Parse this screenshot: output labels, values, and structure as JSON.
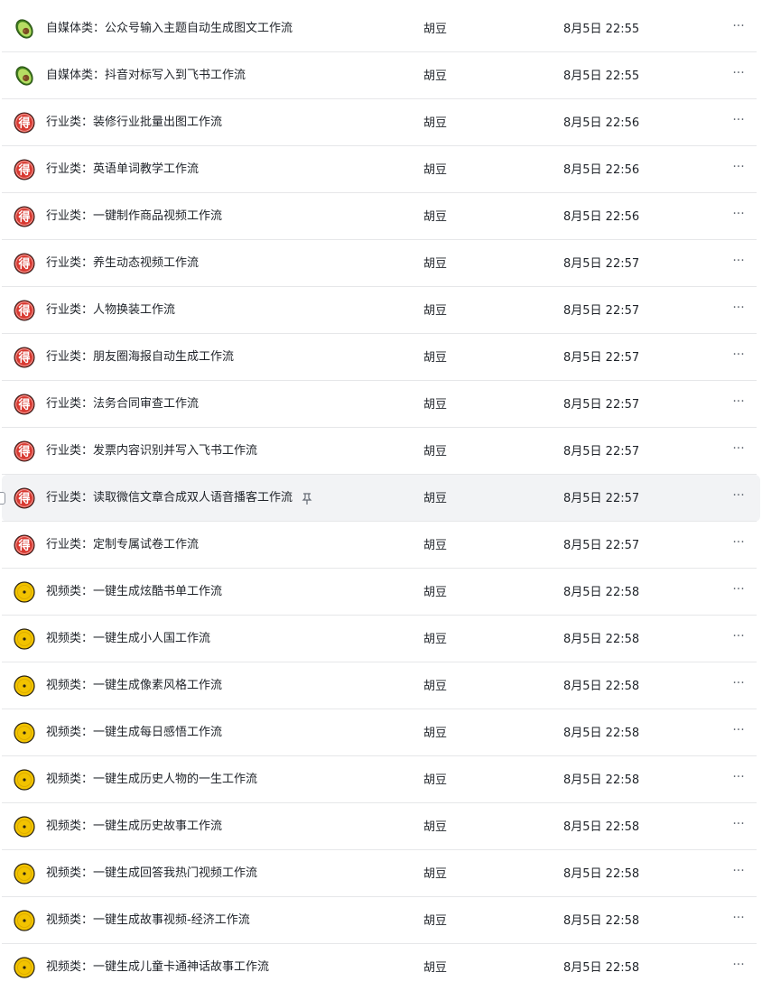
{
  "colors": {
    "row_divider": "#e6e7e9",
    "hover_bg": "#f2f3f5",
    "text": "#1f2329",
    "muted": "#646a73",
    "icon_red": "#d83931",
    "icon_yellow": "#f2c300",
    "icon_green": "#7cc341"
  },
  "more_glyph": "···",
  "rows": [
    {
      "icon": "avocado-icon",
      "title": "自媒体类：公众号输入主题自动生成图文工作流",
      "owner": "胡豆",
      "time": "8月5日 22:55"
    },
    {
      "icon": "avocado-icon",
      "title": "自媒体类：抖音对标写入到飞书工作流",
      "owner": "胡豆",
      "time": "8月5日 22:55"
    },
    {
      "icon": "de-badge-icon",
      "title": "行业类：装修行业批量出图工作流",
      "owner": "胡豆",
      "time": "8月5日 22:56",
      "badge": "得"
    },
    {
      "icon": "de-badge-icon",
      "title": "行业类：英语单词教学工作流",
      "owner": "胡豆",
      "time": "8月5日 22:56",
      "badge": "得"
    },
    {
      "icon": "de-badge-icon",
      "title": "行业类：一键制作商品视频工作流",
      "owner": "胡豆",
      "time": "8月5日 22:56",
      "badge": "得"
    },
    {
      "icon": "de-badge-icon",
      "title": "行业类：养生动态视频工作流",
      "owner": "胡豆",
      "time": "8月5日 22:57",
      "badge": "得"
    },
    {
      "icon": "de-badge-icon",
      "title": "行业类：人物换装工作流",
      "owner": "胡豆",
      "time": "8月5日 22:57",
      "badge": "得"
    },
    {
      "icon": "de-badge-icon",
      "title": "行业类：朋友圈海报自动生成工作流",
      "owner": "胡豆",
      "time": "8月5日 22:57",
      "badge": "得"
    },
    {
      "icon": "de-badge-icon",
      "title": "行业类：法务合同审查工作流",
      "owner": "胡豆",
      "time": "8月5日 22:57",
      "badge": "得"
    },
    {
      "icon": "de-badge-icon",
      "title": "行业类：发票内容识别并写入飞书工作流",
      "owner": "胡豆",
      "time": "8月5日 22:57",
      "badge": "得"
    },
    {
      "icon": "de-badge-icon",
      "title": "行业类：读取微信文章合成双人语音播客工作流",
      "owner": "胡豆",
      "time": "8月5日 22:57",
      "badge": "得",
      "hovered": true,
      "pin": "pin-icon"
    },
    {
      "icon": "de-badge-icon",
      "title": "行业类：定制专属试卷工作流",
      "owner": "胡豆",
      "time": "8月5日 22:57",
      "badge": "得"
    },
    {
      "icon": "vinyl-disc-icon",
      "title": "视频类：一键生成炫酷书单工作流",
      "owner": "胡豆",
      "time": "8月5日 22:58"
    },
    {
      "icon": "vinyl-disc-icon",
      "title": "视频类：一键生成小人国工作流",
      "owner": "胡豆",
      "time": "8月5日 22:58"
    },
    {
      "icon": "vinyl-disc-icon",
      "title": "视频类：一键生成像素风格工作流",
      "owner": "胡豆",
      "time": "8月5日 22:58"
    },
    {
      "icon": "vinyl-disc-icon",
      "title": "视频类：一键生成每日感悟工作流",
      "owner": "胡豆",
      "time": "8月5日 22:58"
    },
    {
      "icon": "vinyl-disc-icon",
      "title": "视频类：一键生成历史人物的一生工作流",
      "owner": "胡豆",
      "time": "8月5日 22:58"
    },
    {
      "icon": "vinyl-disc-icon",
      "title": "视频类：一键生成历史故事工作流",
      "owner": "胡豆",
      "time": "8月5日 22:58"
    },
    {
      "icon": "vinyl-disc-icon",
      "title": "视频类：一键生成回答我热门视频工作流",
      "owner": "胡豆",
      "time": "8月5日 22:58"
    },
    {
      "icon": "vinyl-disc-icon",
      "title": "视频类：一键生成故事视频-经济工作流",
      "owner": "胡豆",
      "time": "8月5日 22:58"
    },
    {
      "icon": "vinyl-disc-icon",
      "title": "视频类：一键生成儿童卡通神话故事工作流",
      "owner": "胡豆",
      "time": "8月5日 22:58"
    }
  ]
}
